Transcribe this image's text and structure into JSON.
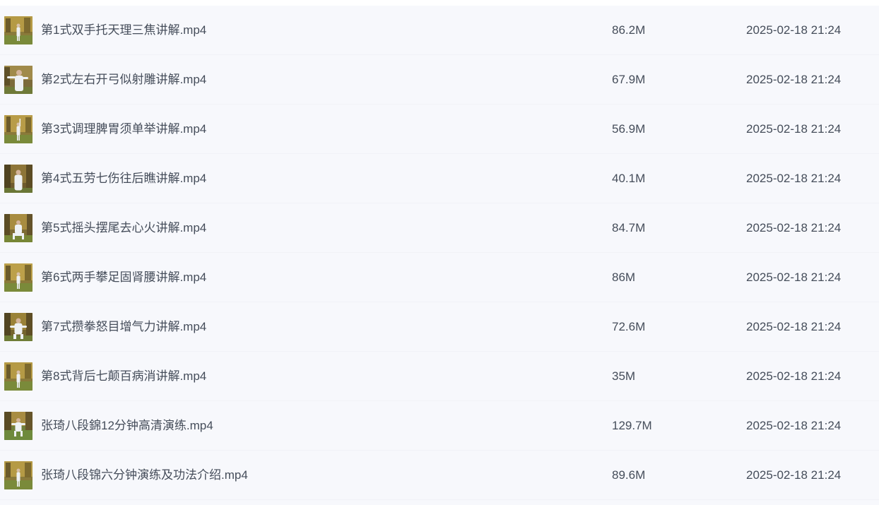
{
  "files": [
    {
      "name": "第1式双手托天理三焦讲解.mp4",
      "size": "86.2M",
      "date": "2025-02-18 21:24",
      "thumbnail_icon": "video-thumbnail-icon"
    },
    {
      "name": "第2式左右开弓似射雕讲解.mp4",
      "size": "67.9M",
      "date": "2025-02-18 21:24",
      "thumbnail_icon": "video-thumbnail-icon"
    },
    {
      "name": "第3式调理脾胃须单举讲解.mp4",
      "size": "56.9M",
      "date": "2025-02-18 21:24",
      "thumbnail_icon": "video-thumbnail-icon"
    },
    {
      "name": "第4式五劳七伤往后瞧讲解.mp4",
      "size": "40.1M",
      "date": "2025-02-18 21:24",
      "thumbnail_icon": "video-thumbnail-icon"
    },
    {
      "name": "第5式摇头摆尾去心火讲解.mp4",
      "size": "84.7M",
      "date": "2025-02-18 21:24",
      "thumbnail_icon": "video-thumbnail-icon"
    },
    {
      "name": "第6式两手攀足固肾腰讲解.mp4",
      "size": "86M",
      "date": "2025-02-18 21:24",
      "thumbnail_icon": "video-thumbnail-icon"
    },
    {
      "name": "第7式攒拳怒目增气力讲解.mp4",
      "size": "72.6M",
      "date": "2025-02-18 21:24",
      "thumbnail_icon": "video-thumbnail-icon"
    },
    {
      "name": "第8式背后七颠百病消讲解.mp4",
      "size": "35M",
      "date": "2025-02-18 21:24",
      "thumbnail_icon": "video-thumbnail-icon"
    },
    {
      "name": "张琦八段錦12分钟高清演练.mp4",
      "size": "129.7M",
      "date": "2025-02-18 21:24",
      "thumbnail_icon": "video-thumbnail-icon"
    },
    {
      "name": "张琦八段锦六分钟演练及功法介绍.mp4",
      "size": "89.6M",
      "date": "2025-02-18 21:24",
      "thumbnail_icon": "video-thumbnail-icon"
    }
  ]
}
